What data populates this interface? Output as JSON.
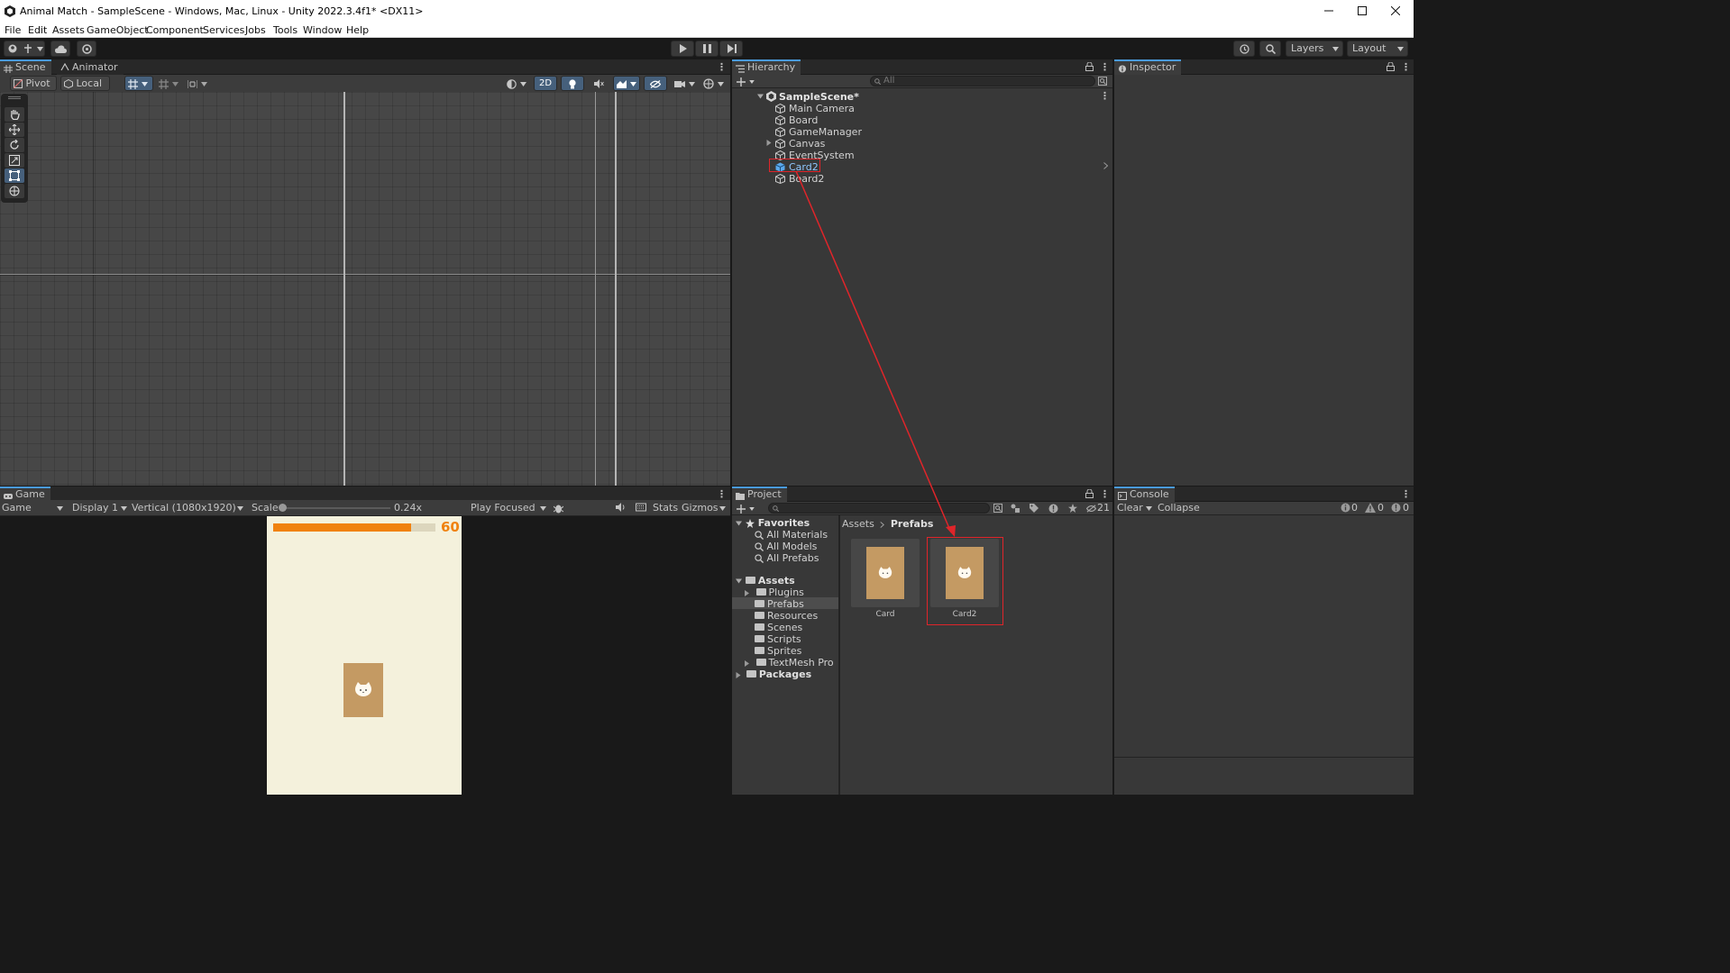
{
  "window": {
    "title": "Animal Match - SampleScene - Windows, Mac, Linux - Unity 2022.3.4f1* <DX11>",
    "controls": [
      "minimize",
      "maximize",
      "close"
    ]
  },
  "menu": [
    "File",
    "Edit",
    "Assets",
    "GameObject",
    "Component",
    "Services",
    "Jobs",
    "Tools",
    "Window",
    "Help"
  ],
  "toolbar": {
    "layers": "Layers",
    "layout": "Layout"
  },
  "scene_panel": {
    "tabs": [
      "Scene",
      "Animator"
    ],
    "pivot": "Pivot",
    "local": "Local",
    "mode_2d": "2D"
  },
  "game_panel": {
    "tab": "Game",
    "mode": "Game",
    "display": "Display 1",
    "resolution": "Vertical (1080x1920)",
    "scale_label": "Scale",
    "scale_value": "0.24x",
    "play_focused": "Play Focused",
    "stats": "Stats",
    "gizmos": "Gizmos",
    "timer_value": "60",
    "timer_fill": 0.85
  },
  "hierarchy": {
    "tab": "Hierarchy",
    "search_placeholder": "All",
    "scene": "SampleScene*",
    "items": [
      "Main Camera",
      "Board",
      "GameManager",
      "Canvas",
      "EventSystem",
      "Card2",
      "Board2"
    ],
    "selected": "Card2"
  },
  "inspector": {
    "tab": "Inspector"
  },
  "project": {
    "tab": "Project",
    "filter_count": "21",
    "favorites_label": "Favorites",
    "favorites": [
      "All Materials",
      "All Models",
      "All Prefabs"
    ],
    "assets_label": "Assets",
    "assets_folders": [
      "Plugins",
      "Prefabs",
      "Resources",
      "Scenes",
      "Scripts",
      "Sprites",
      "TextMesh Pro"
    ],
    "packages_label": "Packages",
    "breadcrumb": [
      "Assets",
      "Prefabs"
    ],
    "grid_items": [
      "Card",
      "Card2"
    ]
  },
  "console": {
    "tab": "Console",
    "clear": "Clear",
    "collapse": "Collapse",
    "log_count": "0",
    "warn_count": "0",
    "error_count": "0"
  },
  "colors": {
    "accent_selection": "#2c5d87",
    "highlight_red": "#e0252a",
    "card_tan": "#c49a63",
    "game_bg": "#f4f1dc",
    "timer_orange": "#f0820f"
  }
}
